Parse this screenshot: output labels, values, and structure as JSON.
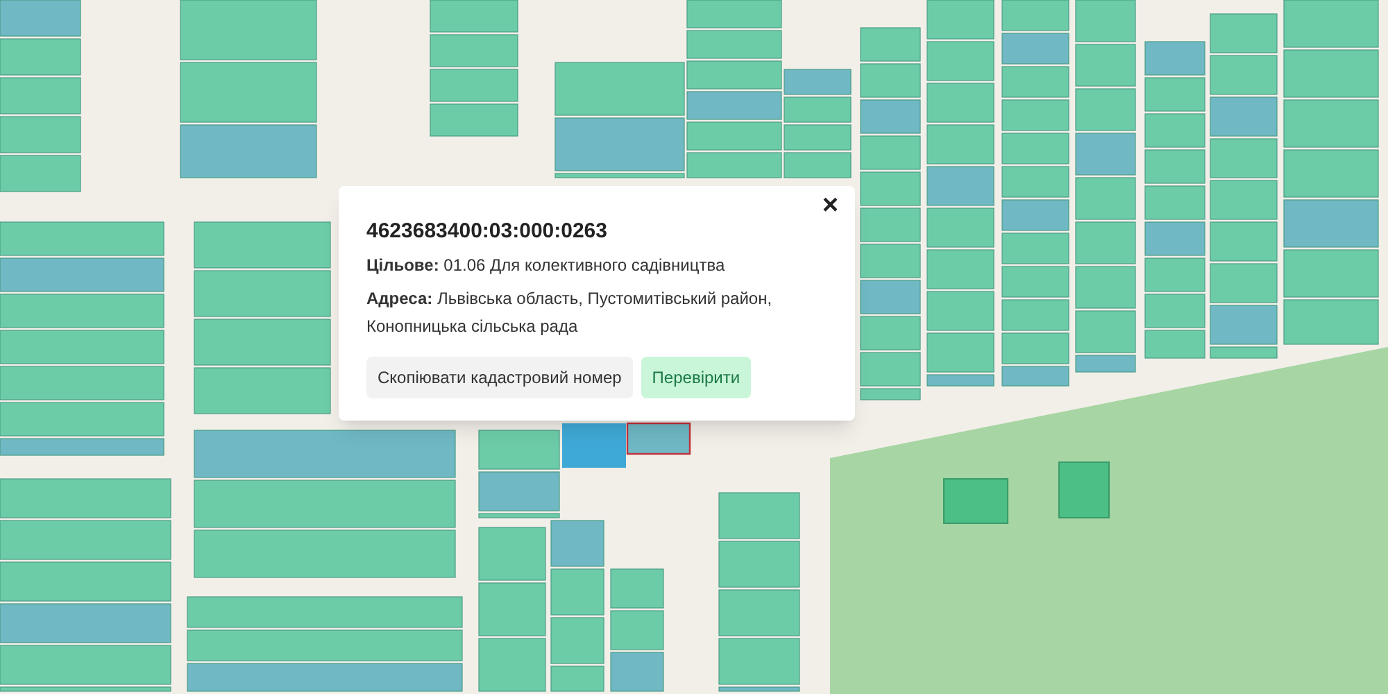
{
  "popup": {
    "title": "4623683400:03:000:0263",
    "details": [
      "**Цільове:** 01.06 Для колективного садівництва",
      "**Адреса:** Львівська область, Пустомитівський район, Конопницька сільська рада"
    ],
    "buttons": [
      {
        "label": "Скопіювати кадастровий номер",
        "kind": "secondary"
      },
      {
        "label": "Перевірити",
        "kind": "primary"
      }
    ],
    "close": "×"
  }
}
